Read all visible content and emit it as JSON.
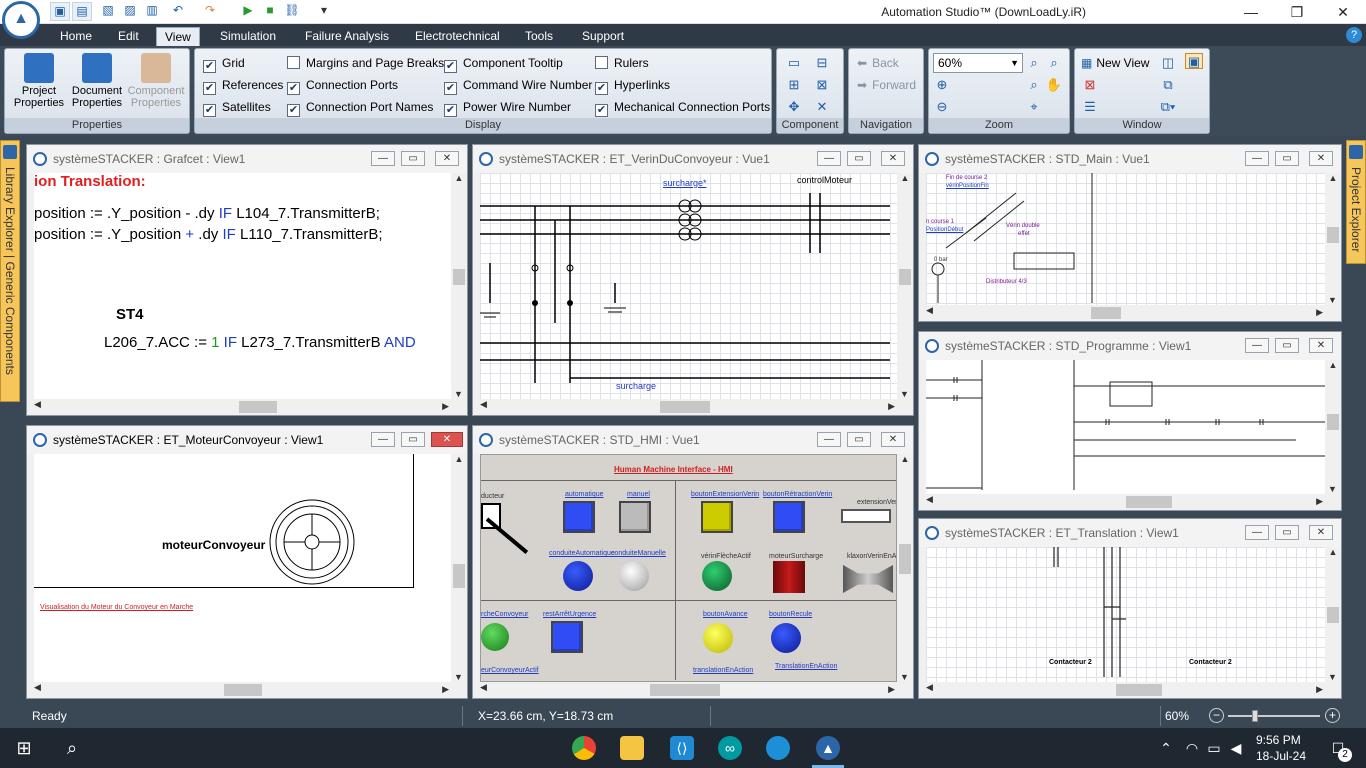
{
  "app": {
    "title": "Automation Studio™ (DownLoadLy.iR)",
    "status": "Ready",
    "coordinates": "X=23.66 cm, Y=18.73 cm",
    "zoom": "60%"
  },
  "tabs": [
    "Home",
    "Edit",
    "View",
    "Simulation",
    "Failure Analysis",
    "Electrotechnical",
    "Tools",
    "Support"
  ],
  "ribbon": {
    "properties": {
      "label": "Properties",
      "project": "Project Properties",
      "document": "Document Properties",
      "component": "Component Properties"
    },
    "display": {
      "label": "Display",
      "grid": "Grid",
      "references": "References",
      "satellites": "Satellites",
      "margins": "Margins and Page Breaks",
      "connection_ports": "Connection Ports",
      "connection_port_names": "Connection Port Names",
      "component_tooltip": "Component Tooltip",
      "command_wire": "Command Wire Number",
      "power_wire": "Power Wire Number",
      "rulers": "Rulers",
      "hyperlinks": "Hyperlinks",
      "mech_ports": "Mechanical Connection Ports"
    },
    "component_label": "Component",
    "navigation": {
      "label": "Navigation",
      "back": "Back",
      "forward": "Forward"
    },
    "zoom": {
      "label": "Zoom",
      "value": "60%"
    },
    "window": {
      "label": "Window",
      "new_view": "New View"
    }
  },
  "side": {
    "left": "Library Explorer | Generic Components",
    "right": "Project Explorer"
  },
  "windows": {
    "w1": {
      "title": "systèmeSTACKER : Grafcet : View1",
      "heading": "ion Translation:",
      "line1a": "position := .Y_position - .dy ",
      "line1b": "IF",
      "line1c": " L104_7.TransmitterB;",
      "line2a": "position := .Y_position ",
      "line2b": "+",
      "line2c": " .dy ",
      "line2d": "IF",
      "line2e": " L110_7.TransmitterB;",
      "st": "ST4",
      "line3a": "L206_7.ACC := ",
      "line3b": "1",
      "line3c": " IF",
      "line3d": " L273_7.TransmitterB ",
      "line3e": "AND"
    },
    "w2": {
      "title": "systèmeSTACKER : ET_VerinDuConvoyeur : Vue1",
      "surcharge1": "surcharge*",
      "control": "controlMoteur",
      "surcharge2": "surcharge"
    },
    "w3": {
      "title": "systèmeSTACKER : STD_Main : Vue1",
      "fin": "Fin de course 2",
      "vf": "vérinPositionFin",
      "debut": "n course 1",
      "pd": "PositionDébut",
      "verin": "Vérin double",
      "effet": "effet",
      "bar": "0 bar",
      "dist": "Distributeur 4/3"
    },
    "w4": {
      "title": "systèmeSTACKER : ET_MoteurConvoyeur : View1",
      "motor": "moteurConvoyeur",
      "visu": "Visualisation du Moteur du Convoyeur en Marche"
    },
    "w5": {
      "title": "systèmeSTACKER : STD_HMI : Vue1",
      "header": "Human Machine Interface - HMI",
      "labels": [
        "automatique",
        "manuel",
        "boutonExtensionVerin",
        "boutonRétractionVerin",
        "extensionVer",
        "conduiteAutomatique",
        "conduiteManuelle",
        "vérinFlècheActif",
        "moteurSurcharge",
        "klaxonVerinEnAc",
        "rcheConvoyeur",
        "restArrêtUrgence",
        "boutonAvance",
        "boutonRecule",
        "translationEnAction",
        "TranslationEnAction",
        "ducteur",
        "eurConvoyeurActif"
      ]
    },
    "w6": {
      "title": "systèmeSTACKER : STD_Programme : View1"
    },
    "w7": {
      "title": "systèmeSTACKER : ET_Translation : View1",
      "c1": "Contacteur 2",
      "c2": "Contacteur 2"
    }
  },
  "taskbar": {
    "time": "9:56 PM",
    "date": "18-Jul-24",
    "notif": "2"
  }
}
